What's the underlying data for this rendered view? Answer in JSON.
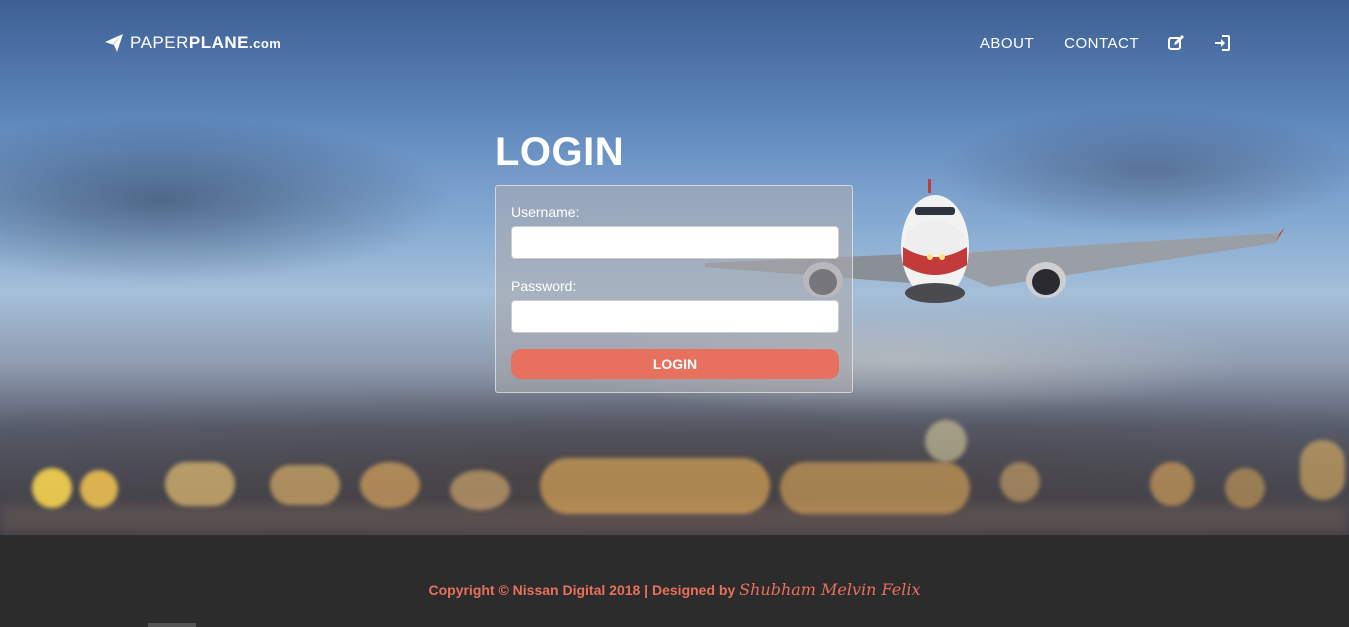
{
  "brand": {
    "part1": "PAPER",
    "part2": "PLANE",
    "tld": ".com"
  },
  "nav": {
    "items": [
      {
        "label": "ABOUT"
      },
      {
        "label": "CONTACT"
      }
    ],
    "icons": [
      "edit-icon",
      "login-icon"
    ]
  },
  "login": {
    "title": "LOGIN",
    "username_label": "Username:",
    "username_value": "",
    "password_label": "Password:",
    "password_value": "",
    "submit_label": "LOGIN"
  },
  "footer": {
    "copyright": "Copyright © Nissan Digital 2018 | Designed by ",
    "designer": "Shubham Melvin Felix"
  },
  "colors": {
    "accent": "#e8705e",
    "footer_bg": "#2c2c2c"
  }
}
